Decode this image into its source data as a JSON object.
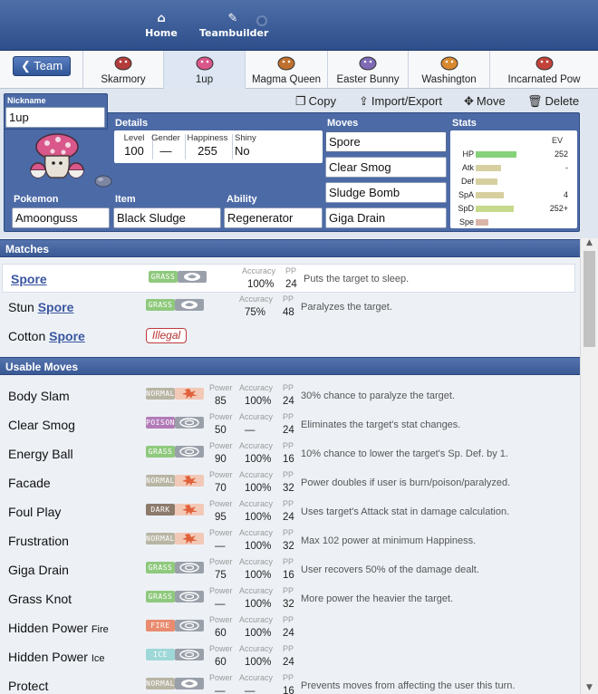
{
  "nav": {
    "home_label": "Home",
    "teambuilder_label": "Teambuilder"
  },
  "team": {
    "back_label": "Team",
    "slots": [
      "Skarmory",
      "1up",
      "Magma Queen",
      "Easter Bunny",
      "Washington",
      "Incarnated Pow"
    ]
  },
  "toolbar": {
    "copy_label": "Copy",
    "import_export_label": "Import/Export",
    "move_label": "Move",
    "delete_label": "Delete"
  },
  "set": {
    "nickname_label": "Nickname",
    "nickname": "1up",
    "details_label": "Details",
    "level_label": "Level",
    "level": "100",
    "gender_label": "Gender",
    "gender": "—",
    "happiness_label": "Happiness",
    "happiness": "255",
    "shiny_label": "Shiny",
    "shiny": "No",
    "pokemon_label": "Pokemon",
    "pokemon": "Amoonguss",
    "item_label": "Item",
    "item": "Black Sludge",
    "ability_label": "Ability",
    "ability": "Regenerator",
    "moves_label": "Moves",
    "moves": [
      "Spore",
      "Clear Smog",
      "Sludge Bomb",
      "Giga Drain"
    ],
    "stats_label": "Stats",
    "ev_label": "EV",
    "stats": [
      {
        "name": "HP",
        "bar": 0.41,
        "color": "#86d27a",
        "ev": "252"
      },
      {
        "name": "Atk",
        "bar": 0.25,
        "color": "#d6d0a0",
        "ev": "-"
      },
      {
        "name": "Def",
        "bar": 0.22,
        "color": "#d6d0a0",
        "ev": ""
      },
      {
        "name": "SpA",
        "bar": 0.28,
        "color": "#d6d0a0",
        "ev": "4"
      },
      {
        "name": "SpD",
        "bar": 0.38,
        "color": "#c6d98c",
        "ev": "252+"
      },
      {
        "name": "Spe",
        "bar": 0.13,
        "color": "#d9b5a8",
        "ev": ""
      }
    ]
  },
  "matches": {
    "title": "Matches",
    "rows": [
      {
        "prefix": "",
        "hl": "Spore",
        "type": "GRASS",
        "tcolor": "#8fc97d",
        "cat": "status",
        "power": "",
        "acc": "100%",
        "pp": "24",
        "desc": "Puts the target to sleep."
      },
      {
        "prefix": "Stun ",
        "hl": "Spore",
        "type": "GRASS",
        "tcolor": "#8fc97d",
        "cat": "status",
        "power": "",
        "acc": "75%",
        "pp": "48",
        "desc": "Paralyzes the target."
      },
      {
        "prefix": "Cotton ",
        "hl": "Spore",
        "illegal": "Illegal"
      }
    ]
  },
  "usable": {
    "title": "Usable Moves",
    "power_key": "Power",
    "accuracy_key": "Accuracy",
    "pp_key": "PP",
    "rows": [
      {
        "name": "Body Slam",
        "small": "",
        "type": "NORMAL",
        "tcolor": "#b8b5a4",
        "cat": "physical",
        "power": "85",
        "acc": "100%",
        "pp": "24",
        "desc": "30% chance to paralyze the target."
      },
      {
        "name": "Clear Smog",
        "small": "",
        "type": "POISON",
        "tcolor": "#b27bb8",
        "cat": "special",
        "power": "50",
        "acc": "—",
        "pp": "24",
        "desc": "Eliminates the target's stat changes."
      },
      {
        "name": "Energy Ball",
        "small": "",
        "type": "GRASS",
        "tcolor": "#8fc97d",
        "cat": "special",
        "power": "90",
        "acc": "100%",
        "pp": "16",
        "desc": "10% chance to lower the target's Sp. Def. by 1."
      },
      {
        "name": "Facade",
        "small": "",
        "type": "NORMAL",
        "tcolor": "#b8b5a4",
        "cat": "physical",
        "power": "70",
        "acc": "100%",
        "pp": "32",
        "desc": "Power doubles if user is burn/poison/paralyzed."
      },
      {
        "name": "Foul Play",
        "small": "",
        "type": "DARK",
        "tcolor": "#8c7a6b",
        "cat": "physical",
        "power": "95",
        "acc": "100%",
        "pp": "24",
        "desc": "Uses target's Attack stat in damage calculation."
      },
      {
        "name": "Frustration",
        "small": "",
        "type": "NORMAL",
        "tcolor": "#b8b5a4",
        "cat": "physical",
        "power": "—",
        "acc": "100%",
        "pp": "32",
        "desc": "Max 102 power at minimum Happiness."
      },
      {
        "name": "Giga Drain",
        "small": "",
        "type": "GRASS",
        "tcolor": "#8fc97d",
        "cat": "special",
        "power": "75",
        "acc": "100%",
        "pp": "16",
        "desc": "User recovers 50% of the damage dealt."
      },
      {
        "name": "Grass Knot",
        "small": "",
        "type": "GRASS",
        "tcolor": "#8fc97d",
        "cat": "special",
        "power": "—",
        "acc": "100%",
        "pp": "32",
        "desc": "More power the heavier the target."
      },
      {
        "name": "Hidden Power ",
        "small": "Fire",
        "type": "FIRE",
        "tcolor": "#e98b6f",
        "cat": "special",
        "power": "60",
        "acc": "100%",
        "pp": "24",
        "desc": ""
      },
      {
        "name": "Hidden Power ",
        "small": "Ice",
        "type": "ICE",
        "tcolor": "#9ed8d8",
        "cat": "special",
        "power": "60",
        "acc": "100%",
        "pp": "24",
        "desc": ""
      },
      {
        "name": "Protect",
        "small": "",
        "type": "NORMAL",
        "tcolor": "#b8b5a4",
        "cat": "status",
        "power": "—",
        "acc": "—",
        "pp": "16",
        "desc": "Prevents moves from affecting the user this turn."
      }
    ]
  }
}
